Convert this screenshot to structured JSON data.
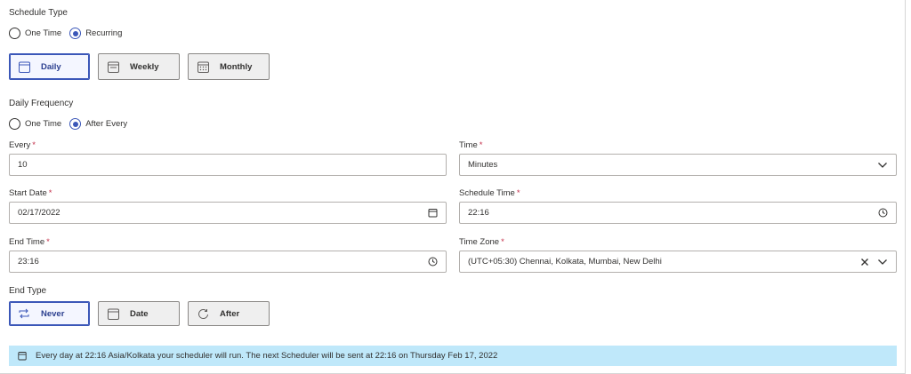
{
  "schedule_type": {
    "label": "Schedule Type",
    "options": [
      {
        "label": "One Time",
        "checked": false
      },
      {
        "label": "Recurring",
        "checked": true
      }
    ]
  },
  "recurrence_tiles": [
    {
      "label": "Daily",
      "icon": "calendar-day-icon",
      "selected": true
    },
    {
      "label": "Weekly",
      "icon": "calendar-week-icon",
      "selected": false
    },
    {
      "label": "Monthly",
      "icon": "calendar-month-icon",
      "selected": false
    }
  ],
  "daily_frequency": {
    "label": "Daily Frequency",
    "options": [
      {
        "label": "One Time",
        "checked": false
      },
      {
        "label": "After Every",
        "checked": true
      }
    ]
  },
  "fields": {
    "every": {
      "label": "Every",
      "value": "10"
    },
    "time": {
      "label": "Time",
      "value": "Minutes"
    },
    "start_date": {
      "label": "Start Date",
      "value": "02/17/2022"
    },
    "schedule_time": {
      "label": "Schedule Time",
      "value": "22:16"
    },
    "end_time": {
      "label": "End Time",
      "value": "23:16"
    },
    "time_zone": {
      "label": "Time Zone",
      "value": "(UTC+05:30) Chennai, Kolkata, Mumbai, New Delhi"
    }
  },
  "required_marker": "*",
  "end_type": {
    "label": "End Type",
    "tiles": [
      {
        "label": "Never",
        "icon": "repeat-icon",
        "selected": true
      },
      {
        "label": "Date",
        "icon": "calendar-icon",
        "selected": false
      },
      {
        "label": "After",
        "icon": "rotate-icon",
        "selected": false
      }
    ]
  },
  "info_banner": {
    "text": "Every day at 22:16 Asia/Kolkata your scheduler will run. The next Scheduler will be sent at 22:16 on Thursday Feb 17, 2022",
    "icon": "calendar-icon"
  },
  "colors": {
    "accent": "#3b57b8",
    "required": "#c4314b",
    "banner_bg": "#bfe8fa",
    "tile_bg": "#efefef",
    "tile_selected_bg": "#f4f6ff"
  }
}
